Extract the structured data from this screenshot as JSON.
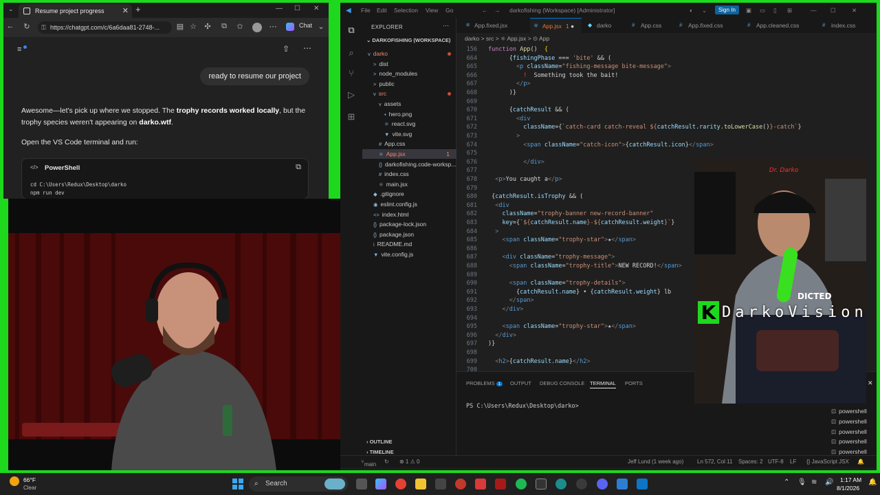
{
  "browser": {
    "tab_title": "Resume project progress",
    "url": "https://chatgpt.com/c/6a6daa81-2748-...",
    "chat_button": "Chat",
    "user_message": "ready to resume our project",
    "para1_a": "Awesome—let's pick up where we stopped. The ",
    "para1_b": "trophy records worked locally",
    "para1_c": ", but the trophy species weren't appearing on ",
    "para1_d": "darko.wtf",
    "para1_e": ".",
    "para2": "Open the VS Code terminal and run:",
    "code_lang": "PowerShell",
    "code_lines": [
      "cd C:\\Users\\Redux\\Desktop\\darko",
      "npm run dev"
    ]
  },
  "vscode": {
    "menu": [
      "File",
      "Edit",
      "Selection",
      "View",
      "Go"
    ],
    "title": "darkofishing (Workspace) [Administrator]",
    "signin": "Sign In",
    "explorer_title": "EXPLORER",
    "workspace": "DARKOFISHING (WORKSPACE)",
    "tree": [
      {
        "label": "darko",
        "indent": 0,
        "icon": "v",
        "color": "#f48771",
        "dot": true
      },
      {
        "label": "dist",
        "indent": 1,
        "icon": ">"
      },
      {
        "label": "node_modules",
        "indent": 1,
        "icon": ">"
      },
      {
        "label": "public",
        "indent": 1,
        "icon": ">"
      },
      {
        "label": "src",
        "indent": 1,
        "icon": "v",
        "color": "#f48771",
        "dot": true
      },
      {
        "label": "assets",
        "indent": 2,
        "icon": "v"
      },
      {
        "label": "hero.png",
        "indent": 3,
        "icon": "▪"
      },
      {
        "label": "react.svg",
        "indent": 3,
        "icon": "⚛"
      },
      {
        "label": "vite.svg",
        "indent": 3,
        "icon": "▼"
      },
      {
        "label": "App.css",
        "indent": 2,
        "icon": "#"
      },
      {
        "label": "App.jsx",
        "indent": 2,
        "icon": "⚛",
        "color": "#f48771",
        "badge": "1",
        "sel": true
      },
      {
        "label": "darkofishing.code-worksp...",
        "indent": 2,
        "icon": "{}"
      },
      {
        "label": "index.css",
        "indent": 2,
        "icon": "#"
      },
      {
        "label": "main.jsx",
        "indent": 2,
        "icon": "⚛"
      },
      {
        "label": ".gitignore",
        "indent": 1,
        "icon": "◆"
      },
      {
        "label": "eslint.config.js",
        "indent": 1,
        "icon": "◉"
      },
      {
        "label": "index.html",
        "indent": 1,
        "icon": "<>"
      },
      {
        "label": "package-lock.json",
        "indent": 1,
        "icon": "{}"
      },
      {
        "label": "package.json",
        "indent": 1,
        "icon": "{}"
      },
      {
        "label": "README.md",
        "indent": 1,
        "icon": "i"
      },
      {
        "label": "vite.config.js",
        "indent": 1,
        "icon": "▼"
      }
    ],
    "outline": "OUTLINE",
    "timeline": "TIMELINE",
    "tabs": [
      {
        "label": "App.fixed.jsx",
        "icon": "⚛"
      },
      {
        "label": "App.jsx",
        "icon": "⚛",
        "active": true,
        "badge": "1"
      },
      {
        "label": "darko",
        "icon": "◆"
      },
      {
        "label": "App.css",
        "icon": "#"
      },
      {
        "label": "App.fixed.css",
        "icon": "#"
      },
      {
        "label": "App.cleaned.css",
        "icon": "#"
      },
      {
        "label": "index.css",
        "icon": "#"
      }
    ],
    "breadcrumbs": "darko  >  src  >  ⚛ App.jsx  >  ⊙ App",
    "code": [
      {
        "n": "156",
        "t": "<span class='kw'>function</span> <span style='color:#dcdcaa'>App</span>()  <span class='br'>{</span>",
        "sticky": true
      },
      {
        "n": "664",
        "t": "      {<span class='vr'>fishingPhase</span> === <span class='st'>'bite'</span> && ("
      },
      {
        "n": "665",
        "t": "        <span class='gr'>&lt;</span><span class='tg'>p</span> <span class='at'>className</span>=<span class='st'>\"fishing-message bite-message\"</span><span class='gr'>&gt;</span>"
      },
      {
        "n": "666",
        "t": "          <span style='color:#f14c4c'>!</span>  Something took the bait!"
      },
      {
        "n": "667",
        "t": "        <span class='gr'>&lt;/</span><span class='tg'>p</span><span class='gr'>&gt;</span>"
      },
      {
        "n": "668",
        "t": "      )}"
      },
      {
        "n": "669",
        "t": ""
      },
      {
        "n": "670",
        "t": "      {<span class='vr'>catchResult</span> && ("
      },
      {
        "n": "671",
        "t": "        <span class='gr'>&lt;</span><span class='tg'>div</span>"
      },
      {
        "n": "672",
        "t": "          <span class='at'>className</span>={<span class='st'>`catch-card catch-reveal ${</span><span class='vr'>catchResult</span>.<span class='vr'>rarity</span>.<span style='color:#dcdcaa'>toLowerCase</span>()<span class='st'>}-catch`</span>}"
      },
      {
        "n": "673",
        "t": "        <span class='gr'>&gt;</span>"
      },
      {
        "n": "674",
        "t": "          <span class='gr'>&lt;</span><span class='tg'>span</span> <span class='at'>className</span>=<span class='st'>\"catch-icon\"</span><span class='gr'>&gt;</span>{<span class='vr'>catchResult</span>.<span class='vr'>icon</span>}<span class='gr'>&lt;/</span><span class='tg'>span</span><span class='gr'>&gt;</span>"
      },
      {
        "n": "675",
        "t": ""
      },
      {
        "n": "676",
        "t": "          <span class='gr'>&lt;/</span><span class='tg'>div</span><span class='gr'>&gt;</span>"
      },
      {
        "n": "677",
        "t": ""
      },
      {
        "n": "678",
        "t": "  <span class='gr'>&lt;</span><span class='tg'>p</span><span class='gr'>&gt;</span>You caught a<span class='gr'>&lt;/</span><span class='tg'>p</span><span class='gr'>&gt;</span>"
      },
      {
        "n": "679",
        "t": ""
      },
      {
        "n": "680",
        "t": " {<span class='vr'>catchResult</span>.<span class='vr'>isTrophy</span> && ("
      },
      {
        "n": "681",
        "t": "  <span class='gr'>&lt;</span><span class='tg'>div</span>"
      },
      {
        "n": "682",
        "t": "    <span class='at'>className</span>=<span class='st'>\"trophy-banner new-record-banner\"</span>"
      },
      {
        "n": "683",
        "t": "    <span class='at'>key</span>={<span class='st'>`${</span><span class='vr'>catchResult</span>.<span class='vr'>name</span><span class='st'>}-${</span><span class='vr'>catchResult</span>.<span class='vr'>weight</span><span class='st'>}`</span>}"
      },
      {
        "n": "684",
        "t": "  <span class='gr'>&gt;</span>"
      },
      {
        "n": "685",
        "t": "    <span class='gr'>&lt;</span><span class='tg'>span</span> <span class='at'>className</span>=<span class='st'>\"trophy-star\"</span><span class='gr'>&gt;</span>★<span class='gr'>&lt;/</span><span class='tg'>span</span><span class='gr'>&gt;</span>"
      },
      {
        "n": "686",
        "t": ""
      },
      {
        "n": "687",
        "t": "    <span class='gr'>&lt;</span><span class='tg'>div</span> <span class='at'>className</span>=<span class='st'>\"trophy-message\"</span><span class='gr'>&gt;</span>"
      },
      {
        "n": "688",
        "t": "      <span class='gr'>&lt;</span><span class='tg'>span</span> <span class='at'>className</span>=<span class='st'>\"trophy-title\"</span><span class='gr'>&gt;</span>NEW RECORD!<span class='gr'>&lt;/</span><span class='tg'>span</span><span class='gr'>&gt;</span>"
      },
      {
        "n": "689",
        "t": ""
      },
      {
        "n": "690",
        "t": "      <span class='gr'>&lt;</span><span class='tg'>span</span> <span class='at'>className</span>=<span class='st'>\"trophy-details\"</span><span class='gr'>&gt;</span>"
      },
      {
        "n": "691",
        "t": "        {<span class='vr'>catchResult</span>.<span class='vr'>name</span>} • {<span class='vr'>catchResult</span>.<span class='vr'>weight</span>} lb"
      },
      {
        "n": "692",
        "t": "      <span class='gr'>&lt;/</span><span class='tg'>span</span><span class='gr'>&gt;</span>"
      },
      {
        "n": "693",
        "t": "    <span class='gr'>&lt;/</span><span class='tg'>div</span><span class='gr'>&gt;</span>"
      },
      {
        "n": "694",
        "t": ""
      },
      {
        "n": "695",
        "t": "    <span class='gr'>&lt;</span><span class='tg'>span</span> <span class='at'>className</span>=<span class='st'>\"trophy-star\"</span><span class='gr'>&gt;</span>★<span class='gr'>&lt;/</span><span class='tg'>span</span><span class='gr'>&gt;</span>"
      },
      {
        "n": "696",
        "t": "  <span class='gr'>&lt;/</span><span class='tg'>div</span><span class='gr'>&gt;</span>"
      },
      {
        "n": "697",
        "t": ")}"
      },
      {
        "n": "698",
        "t": ""
      },
      {
        "n": "699",
        "t": "  <span class='gr'>&lt;</span><span class='tg'>h2</span><span class='gr'>&gt;</span>{<span class='vr'>catchResult</span>.<span class='vr'>name</span>}<span class='gr'>&lt;/</span><span class='tg'>h2</span><span class='gr'>&gt;</span>"
      },
      {
        "n": "700",
        "t": ""
      }
    ],
    "panel_tabs": [
      "PROBLEMS",
      "OUTPUT",
      "DEBUG CONSOLE",
      "TERMINAL",
      "PORTS"
    ],
    "problems_count": "1",
    "prompt": "PS C:\\Users\\Redux\\Desktop\\darko>",
    "terminals": [
      "powershell",
      "powershell",
      "powershell",
      "powershell",
      "powershell"
    ],
    "status": {
      "branch": "main",
      "errors": "⊗ 1 ⚠ 0",
      "blame": "Jeff Lund (1 week ago)",
      "position": "Ln 572, Col 11",
      "spaces": "Spaces: 2",
      "encoding": "UTF-8",
      "eol": "LF",
      "language": "{} JavaScript JSX"
    }
  },
  "overlay": {
    "logo_letter": "K",
    "logo_text": "DarkoVision",
    "cap_text": "Dr. Darko",
    "shirt_text": "DICTED"
  },
  "taskbar": {
    "temp": "66°F",
    "weather": "Clear",
    "search": "Search",
    "time": "1:17 AM",
    "date": "8/1/2026"
  }
}
